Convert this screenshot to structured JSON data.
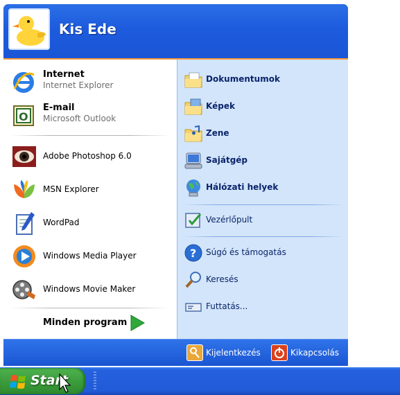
{
  "user": {
    "name": "Kis Ede"
  },
  "pinned": [
    {
      "title": "Internet",
      "subtitle": "Internet Explorer",
      "icon": "internet-explorer-icon"
    },
    {
      "title": "E-mail",
      "subtitle": "Microsoft Outlook",
      "icon": "outlook-icon"
    }
  ],
  "recent": [
    {
      "label": "Adobe Photoshop 6.0",
      "icon": "photoshop-icon"
    },
    {
      "label": "MSN Explorer",
      "icon": "msn-butterfly-icon"
    },
    {
      "label": "WordPad",
      "icon": "wordpad-icon"
    },
    {
      "label": "Windows Media Player",
      "icon": "media-player-icon"
    },
    {
      "label": "Windows Movie Maker",
      "icon": "movie-maker-icon"
    }
  ],
  "all_programs": {
    "label": "Minden program"
  },
  "places": [
    {
      "label": "Dokumentumok",
      "icon": "documents-folder-icon"
    },
    {
      "label": "Képek",
      "icon": "pictures-folder-icon"
    },
    {
      "label": "Zene",
      "icon": "music-folder-icon"
    },
    {
      "label": "Sajátgép",
      "icon": "my-computer-icon"
    },
    {
      "label": "Hálózati helyek",
      "icon": "network-places-icon"
    }
  ],
  "control": [
    {
      "label": "Vezérlőpult",
      "icon": "control-panel-icon"
    }
  ],
  "tools": [
    {
      "label": "Súgó és támogatás",
      "icon": "help-icon"
    },
    {
      "label": "Keresés",
      "icon": "search-icon"
    },
    {
      "label": "Futtatás...",
      "icon": "run-icon"
    }
  ],
  "footer": {
    "logoff": "Kijelentkezés",
    "shutdown": "Kikapcsolás"
  },
  "taskbar": {
    "start": "Start"
  },
  "colors": {
    "accent": "#1f55d2",
    "start_green": "#3c9d3c",
    "right_panel": "#d3e5fa",
    "separator_orange": "#ff9a3a"
  }
}
